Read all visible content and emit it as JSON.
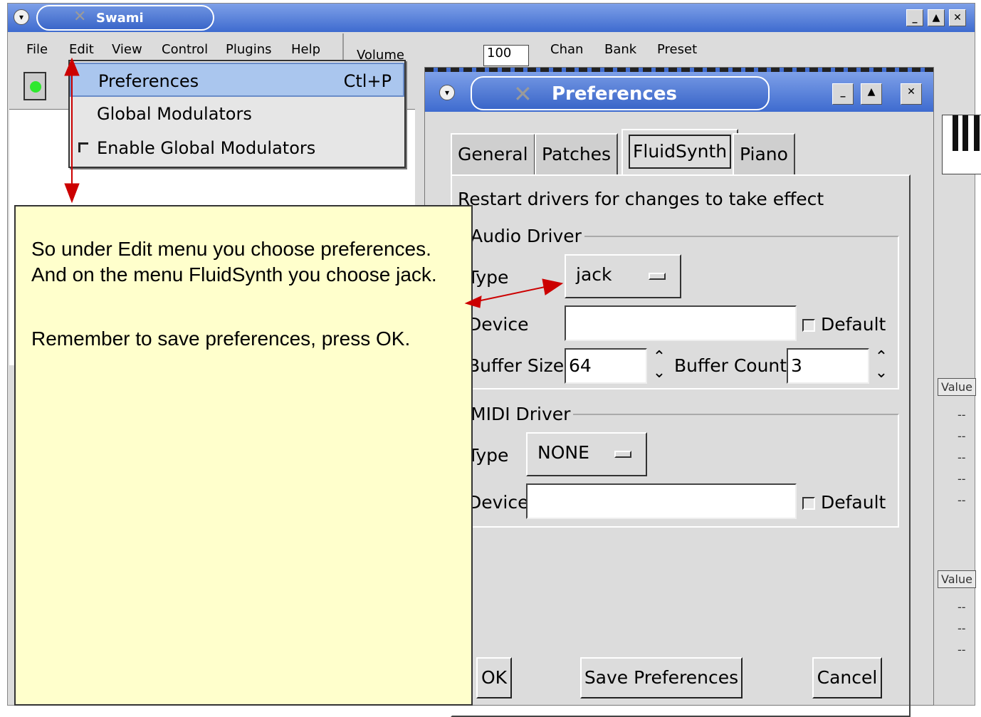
{
  "main_window": {
    "title": "Swami",
    "menus": [
      "File",
      "Edit",
      "View",
      "Control",
      "Plugins",
      "Help"
    ],
    "toolbar": {
      "volume_label": "Volume",
      "volume_value": "100",
      "chan_label": "Chan",
      "bank_label": "Bank",
      "preset_label": "Preset"
    },
    "right_headers": [
      "Value",
      "Value"
    ],
    "right_cells": "--"
  },
  "edit_menu": {
    "items": [
      {
        "label": "Preferences",
        "shortcut": "Ctl+P"
      },
      {
        "label": "Global Modulators"
      },
      {
        "label": "Enable Global Modulators"
      }
    ]
  },
  "preferences": {
    "title": "Preferences",
    "tabs": [
      "General",
      "Patches",
      "FluidSynth",
      "Piano"
    ],
    "active_tab": "FluidSynth",
    "notice": "Restart drivers for changes to take effect",
    "audio": {
      "group": "Audio Driver",
      "type_label": "Type",
      "type_value": "jack",
      "device_label": "Device",
      "device_value": "",
      "default_label": "Default",
      "buffer_size_label": "Buffer Size",
      "buffer_size_value": "64",
      "buffer_count_label": "Buffer Count",
      "buffer_count_value": "3"
    },
    "midi": {
      "group": "MIDI Driver",
      "type_label": "Type",
      "type_value": "NONE",
      "device_label": "Device",
      "device_value": "",
      "default_label": "Default"
    },
    "buttons": {
      "ok": "OK",
      "save": "Save Preferences",
      "cancel": "Cancel"
    }
  },
  "annotation": {
    "line1": "So under Edit menu you choose preferences. And on the menu FluidSynth you choose jack.",
    "line2": "Remember to save preferences, press OK."
  },
  "colors": {
    "note_bg": "#ffffcc",
    "arrow": "#cc0000",
    "title_bar": "#3e6bcf",
    "menu_highlight": "#aac6ee"
  }
}
